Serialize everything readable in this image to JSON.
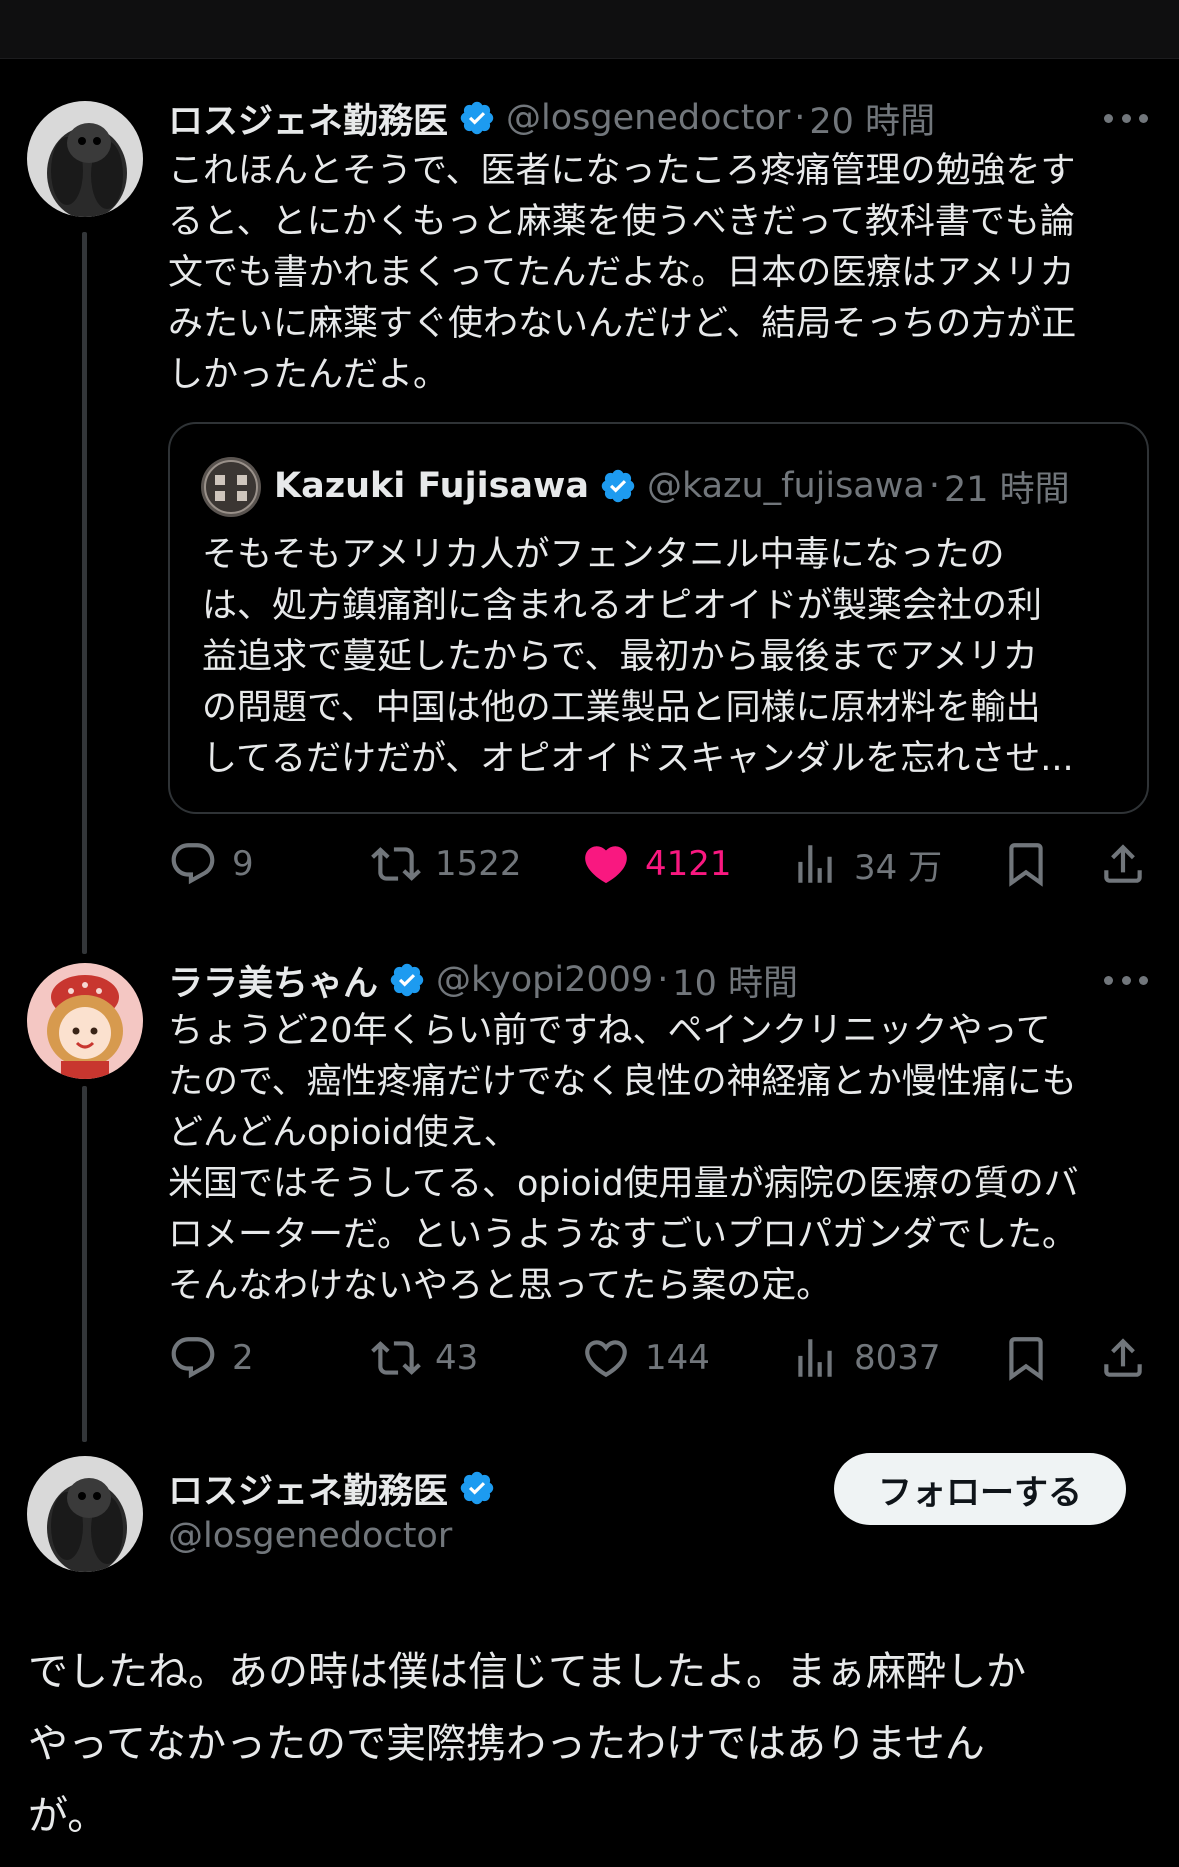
{
  "posts": [
    {
      "display_name": "ロスジェネ勤務医",
      "handle": "@losgenedoctor",
      "separator": "·",
      "time": "20 時間",
      "text": "これほんとそうで、医者になったころ疼痛管理の勉強をす\nると、とにかくもっと麻薬を使うべきだって教科書でも論\n文でも書かれまくってたんだよな。日本の医療はアメリカ\nみたいに麻薬すぐ使わないんだけど、結局そっちの方が正\nしかったんだよ。",
      "quote": {
        "display_name": "Kazuki Fujisawa",
        "handle": "@kazu_fujisawa",
        "separator": "·",
        "time": "21 時間",
        "text": "そもそもアメリカ人がフェンタニル中毒になったの\nは、処方鎮痛剤に含まれるオピオイドが製薬会社の利\n益追求で蔓延したからで、最初から最後までアメリカ\nの問題で、中国は他の工業製品と同様に原材料を輸出\nしてるだけだが、オピオイドスキャンダルを忘れさせ..."
      },
      "stats": {
        "replies": "9",
        "reposts": "1522",
        "likes": "4121",
        "views": "34 万"
      },
      "liked": true
    },
    {
      "display_name": "ララ美ちゃん",
      "handle": "@kyopi2009",
      "separator": "·",
      "time": "10 時間",
      "text": "ちょうど20年くらい前ですね、ペインクリニックやって\nたので、癌性疼痛だけでなく良性の神経痛とか慢性痛にも\nどんどんopioid使え、\n米国ではそうしてる、opioid使用量が病院の医療の質のバ\nロメーターだ。というようなすごいプロパガンダでした。\nそんなわけないやろと思ってたら案の定。",
      "stats": {
        "replies": "2",
        "reposts": "43",
        "likes": "144",
        "views": "8037"
      },
      "liked": false
    }
  ],
  "focused_post": {
    "display_name": "ロスジェネ勤務医",
    "handle": "@losgenedoctor",
    "follow_label": "フォローする",
    "text": "でしたね。あの時は僕は信じてましたよ。まぁ麻酔しか\nやってなかったので実際携わったわけではありません\nが。"
  },
  "colors": {
    "background": "#000000",
    "text": "#e7e9ea",
    "muted": "#71767b",
    "verified": "#1d9bf0",
    "like": "#f91880"
  },
  "icons": [
    "verified-badge-icon",
    "more-icon",
    "reply-icon",
    "repost-icon",
    "like-icon",
    "views-icon",
    "bookmark-icon",
    "share-icon"
  ]
}
